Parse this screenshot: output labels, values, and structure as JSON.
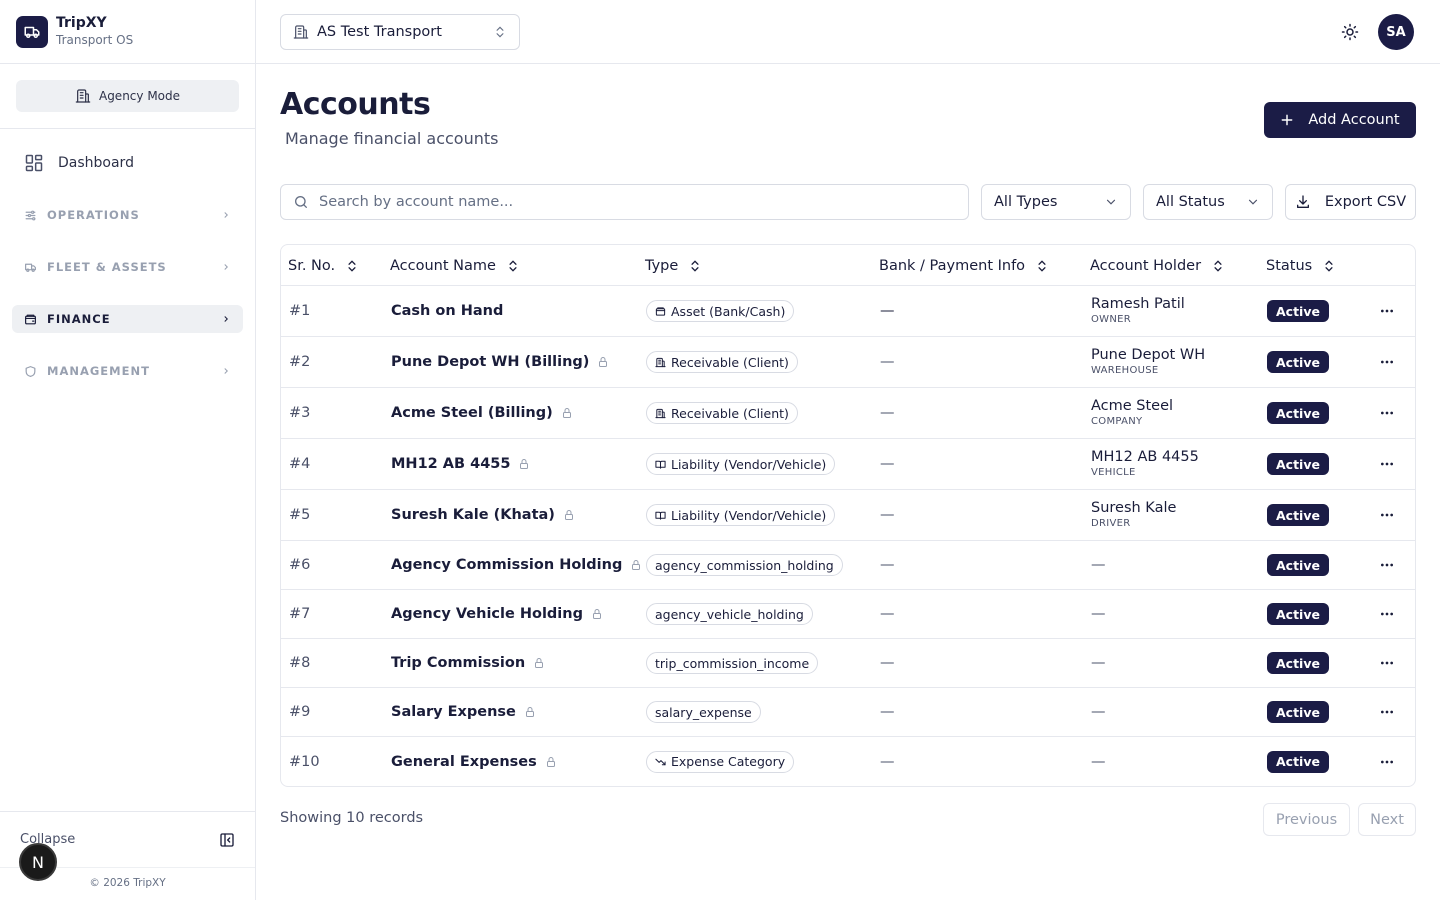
{
  "brand": {
    "title": "TripXY",
    "subtitle": "Transport OS"
  },
  "mode": {
    "label": "Agency Mode"
  },
  "nav": {
    "dashboard": "Dashboard",
    "sections": [
      "OPERATIONS",
      "FLEET & ASSETS",
      "FINANCE",
      "MANAGEMENT"
    ],
    "active": "FINANCE"
  },
  "sidebar_footer": {
    "collapse": "Collapse",
    "copyright": "© 2026 TripXY",
    "avatar_letter": "N"
  },
  "topbar": {
    "org": "AS Test Transport",
    "user_initials": "SA"
  },
  "page": {
    "title": "Accounts",
    "subtitle": "Manage financial accounts",
    "add_button": "Add Account"
  },
  "filters": {
    "search_placeholder": "Search by account name...",
    "types": "All Types",
    "status": "All Status",
    "export": "Export CSV"
  },
  "table": {
    "headers": [
      "Sr. No.",
      "Account Name",
      "Type",
      "Bank / Payment Info",
      "Account Holder",
      "Status"
    ],
    "rows": [
      {
        "num": "#1",
        "name": "Cash on Hand",
        "locked": false,
        "type": "Asset (Bank/Cash)",
        "type_icon": "wallet-icon",
        "bank": "—",
        "holder": "Ramesh Patil",
        "role": "OWNER",
        "status": "Active"
      },
      {
        "num": "#2",
        "name": "Pune Depot WH (Billing)",
        "locked": true,
        "type": "Receivable (Client)",
        "type_icon": "building-icon",
        "bank": "—",
        "holder": "Pune Depot WH",
        "role": "WAREHOUSE",
        "status": "Active"
      },
      {
        "num": "#3",
        "name": "Acme Steel (Billing)",
        "locked": true,
        "type": "Receivable (Client)",
        "type_icon": "building-icon",
        "bank": "—",
        "holder": "Acme Steel",
        "role": "COMPANY",
        "status": "Active"
      },
      {
        "num": "#4",
        "name": "MH12 AB 4455",
        "locked": true,
        "type": "Liability (Vendor/Vehicle)",
        "type_icon": "book-icon",
        "bank": "—",
        "holder": "MH12 AB 4455",
        "role": "VEHICLE",
        "status": "Active"
      },
      {
        "num": "#5",
        "name": "Suresh Kale (Khata)",
        "locked": true,
        "type": "Liability (Vendor/Vehicle)",
        "type_icon": "book-icon",
        "bank": "—",
        "holder": "Suresh Kale",
        "role": "DRIVER",
        "status": "Active"
      },
      {
        "num": "#6",
        "name": "Agency Commission Holding",
        "locked": true,
        "type": "agency_commission_holding",
        "type_icon": "",
        "bank": "—",
        "holder": "—",
        "role": "",
        "status": "Active"
      },
      {
        "num": "#7",
        "name": "Agency Vehicle Holding",
        "locked": true,
        "type": "agency_vehicle_holding",
        "type_icon": "",
        "bank": "—",
        "holder": "—",
        "role": "",
        "status": "Active"
      },
      {
        "num": "#8",
        "name": "Trip Commission",
        "locked": true,
        "type": "trip_commission_income",
        "type_icon": "",
        "bank": "—",
        "holder": "—",
        "role": "",
        "status": "Active"
      },
      {
        "num": "#9",
        "name": "Salary Expense",
        "locked": true,
        "type": "salary_expense",
        "type_icon": "",
        "bank": "—",
        "holder": "—",
        "role": "",
        "status": "Active"
      },
      {
        "num": "#10",
        "name": "General Expenses",
        "locked": true,
        "type": "Expense Category",
        "type_icon": "trend-down-icon",
        "bank": "—",
        "holder": "—",
        "role": "",
        "status": "Active"
      }
    ]
  },
  "footer": {
    "showing": "Showing 10 records",
    "prev": "Previous",
    "next": "Next"
  },
  "colors": {
    "primary": "#1b1c46",
    "border": "#e6e8ee",
    "muted": "#667085"
  }
}
